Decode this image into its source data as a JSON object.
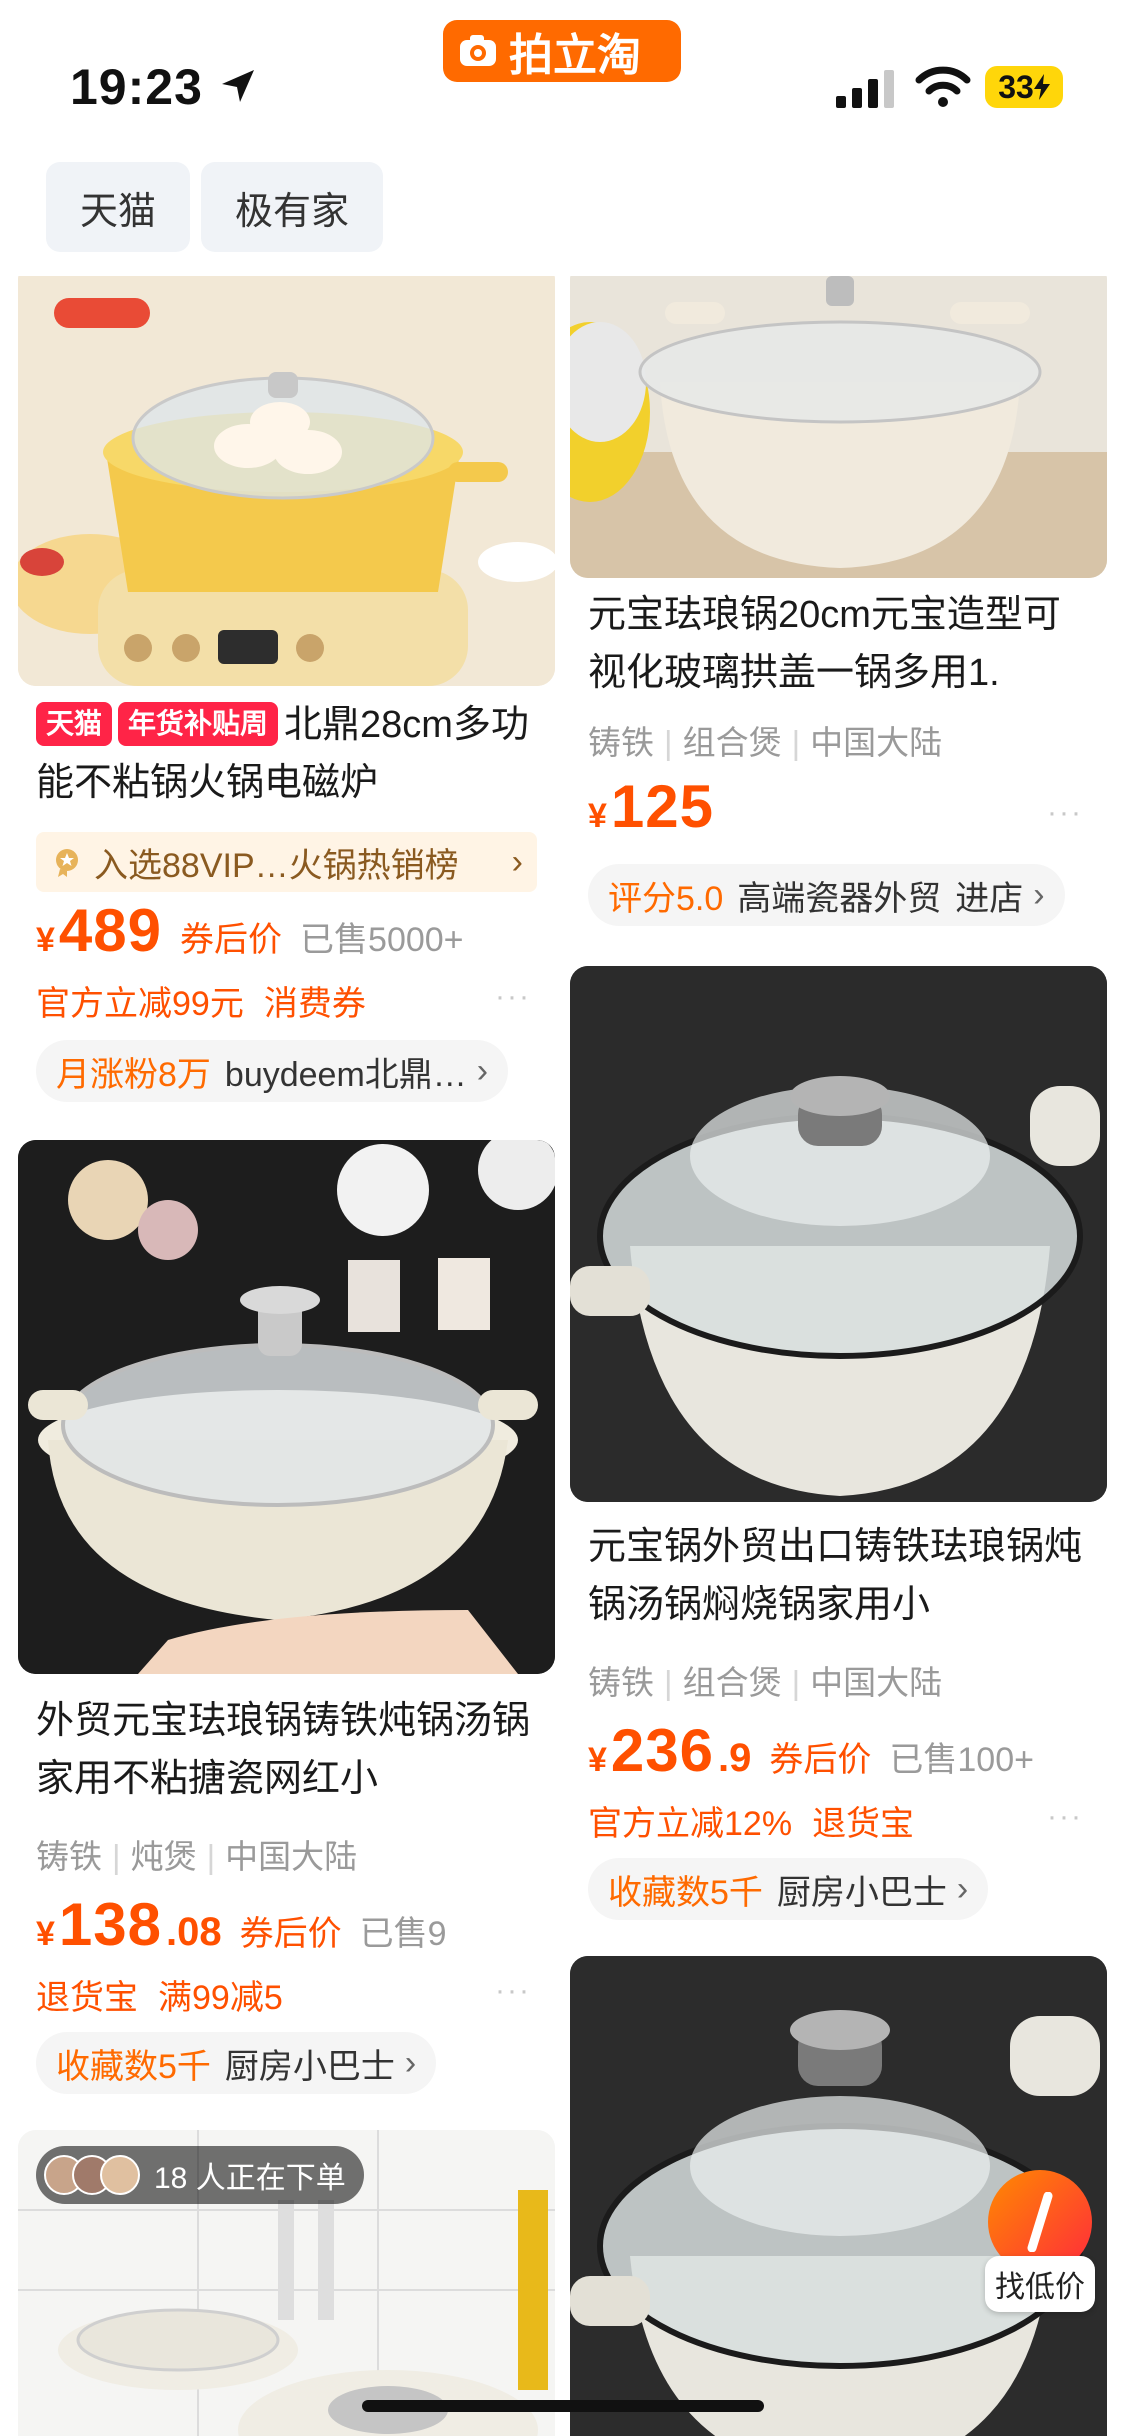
{
  "status_bar": {
    "time": "19:23",
    "app_badge": "拍立淘",
    "battery": "33"
  },
  "filters": [
    {
      "label": "天猫"
    },
    {
      "label": "极有家"
    }
  ],
  "left_column": [
    {
      "tags": [
        "天猫",
        "年货补贴周"
      ],
      "title": "北鼎28cm多功能不粘锅火锅电磁炉",
      "rank": "入选88VIP…火锅热销榜",
      "price_yen": "¥",
      "price": "489",
      "price_cents": "",
      "after_coupon": "券后价",
      "sold": "已售5000+",
      "promos": [
        "官方立减99元",
        "消费券"
      ],
      "shop_highlight": "月涨粉8万",
      "shop_name": "buydeem北鼎…"
    },
    {
      "title": "外贸元宝珐琅锅铸铁炖锅汤锅家用不粘搪瓷网红小",
      "attrs": [
        "铸铁",
        "炖煲",
        "中国大陆"
      ],
      "price_yen": "¥",
      "price": "138",
      "price_cents": ".08",
      "after_coupon": "券后价",
      "sold": "已售9",
      "promos": [
        "退货宝",
        "满99减5"
      ],
      "shop_highlight": "收藏数5千",
      "shop_name": "厨房小巴士"
    },
    {
      "ordering": "18 人正在下单"
    }
  ],
  "right_column": [
    {
      "title": "元宝珐琅锅20cm元宝造型可视化玻璃拱盖一锅多用1.",
      "attrs": [
        "铸铁",
        "组合煲",
        "中国大陆"
      ],
      "price_yen": "¥",
      "price": "125",
      "shop_highlight": "评分5.0",
      "shop_name": "高端瓷器外贸",
      "shop_action": "进店"
    },
    {
      "title": "元宝锅外贸出口铸铁珐琅锅炖锅汤锅焖烧锅家用小",
      "attrs": [
        "铸铁",
        "组合煲",
        "中国大陆"
      ],
      "price_yen": "¥",
      "price": "236",
      "price_cents": ".9",
      "after_coupon": "券后价",
      "sold": "已售100+",
      "promos": [
        "官方立减12%",
        "退货宝"
      ],
      "shop_highlight": "收藏数5千",
      "shop_name": "厨房小巴士"
    },
    {}
  ],
  "float_button": {
    "label": "找低价"
  },
  "more_dots": "···",
  "chevron": "›",
  "colors": {
    "accent": "#ff5000",
    "brand_orange": "#ff6a00",
    "tmall_red": "#ff2447",
    "chip_bg": "#f0f3f7"
  }
}
